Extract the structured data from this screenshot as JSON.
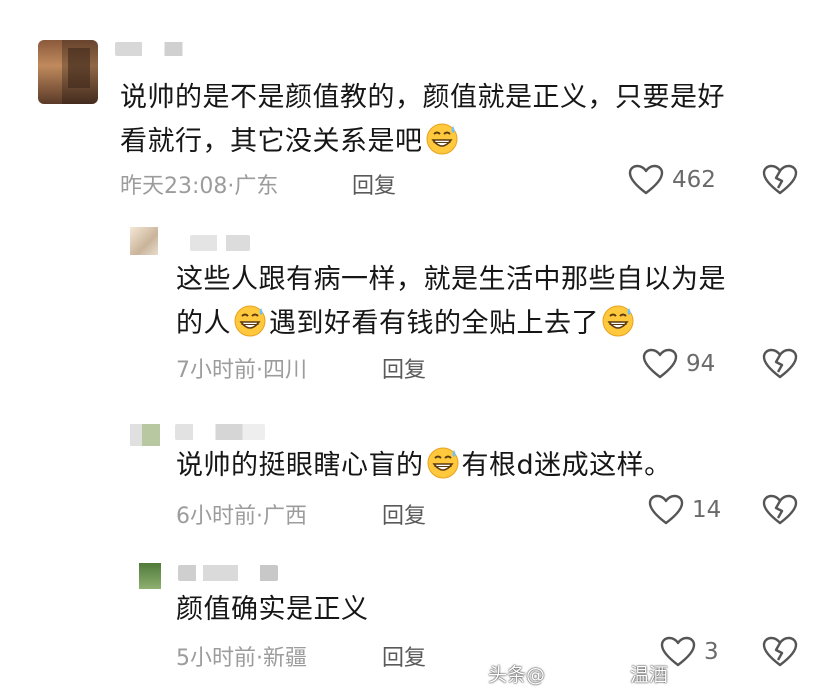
{
  "comments": [
    {
      "text_line1": "说帅的是不是颜值教的，颜值就是正义，只要是好",
      "text_line2": "看就行，其它没关系是吧",
      "time": "昨天23:08",
      "location": "广东",
      "reply_label": "回复",
      "likes": "462"
    },
    {
      "text_line1": "这些人跟有病一样，就是生活中那些自以为是",
      "text_line2_a": "的人",
      "text_line2_b": "遇到好看有钱的全贴上去了",
      "time": "7小时前",
      "location": "四川",
      "reply_label": "回复",
      "likes": "94"
    },
    {
      "text_a": "说帅的挺眼瞎心盲的",
      "text_b": "有根d迷成这样。",
      "time": "6小时前",
      "location": "广西",
      "reply_label": "回复",
      "likes": "14"
    },
    {
      "text": "颜值确实是正义",
      "time": "5小时前",
      "location": "新疆",
      "reply_label": "回复",
      "likes": "3"
    }
  ],
  "separator": "·",
  "watermark": {
    "left": "头条@",
    "right": "温酒"
  },
  "icons": {
    "like": "heart-outline-icon",
    "dislike": "broken-heart-icon",
    "emoji": "grinning-sweat-emoji"
  },
  "colors": {
    "text": "#161616",
    "meta": "#9c9c9c",
    "icon": "#555555",
    "emoji_face": "#ffcc33"
  }
}
